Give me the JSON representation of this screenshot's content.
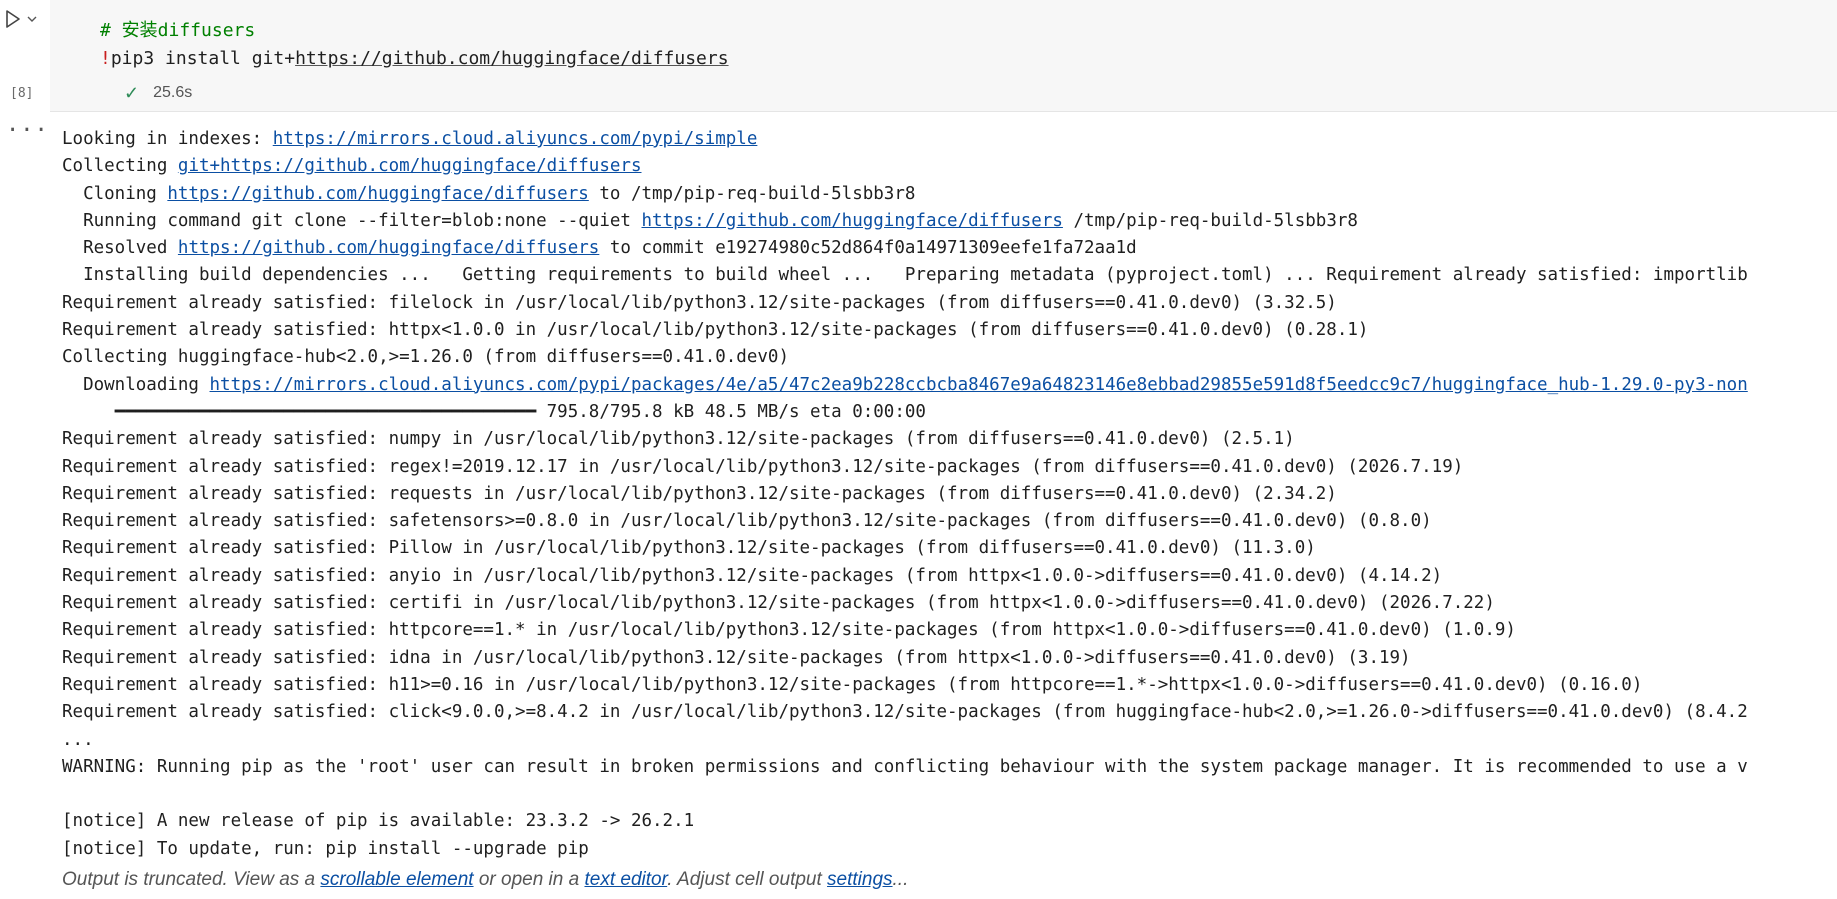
{
  "cell": {
    "code_comment": "# 安装diffusers",
    "code_bang": "!",
    "code_cmd": "pip3 install git+",
    "code_url": "https://github.com/huggingface/diffusers",
    "exec_count": "[8]",
    "duration": "25.6s",
    "run_icon": "play-icon",
    "chevron_icon": "chevron-down-icon",
    "more_icon": "ellipsis-icon"
  },
  "output": {
    "lines": [
      {
        "pre": "Looking in indexes: ",
        "link": "https://mirrors.cloud.aliyuncs.com/pypi/simple",
        "post": ""
      },
      {
        "pre": "Collecting ",
        "link": "git+https://github.com/huggingface/diffusers",
        "post": ""
      },
      {
        "pre": "  Cloning ",
        "link": "https://github.com/huggingface/diffusers",
        "post": " to /tmp/pip-req-build-5lsbb3r8"
      },
      {
        "pre": "  Running command git clone --filter=blob:none --quiet ",
        "link": "https://github.com/huggingface/diffusers",
        "post": " /tmp/pip-req-build-5lsbb3r8"
      },
      {
        "pre": "  Resolved ",
        "link": "https://github.com/huggingface/diffusers",
        "post": " to commit e19274980c52d864f0a14971309eefe1fa72aa1d"
      },
      {
        "pre": "  Installing build dependencies ...   Getting requirements to build wheel ...   Preparing metadata (pyproject.toml) ... Requirement already satisfied: importlib",
        "link": "",
        "post": ""
      },
      {
        "pre": "Requirement already satisfied: filelock in /usr/local/lib/python3.12/site-packages (from diffusers==0.41.0.dev0) (3.32.5)",
        "link": "",
        "post": ""
      },
      {
        "pre": "Requirement already satisfied: httpx<1.0.0 in /usr/local/lib/python3.12/site-packages (from diffusers==0.41.0.dev0) (0.28.1)",
        "link": "",
        "post": ""
      },
      {
        "pre": "Collecting huggingface-hub<2.0,>=1.26.0 (from diffusers==0.41.0.dev0)",
        "link": "",
        "post": ""
      },
      {
        "pre": "  Downloading ",
        "link": "https://mirrors.cloud.aliyuncs.com/pypi/packages/4e/a5/47c2ea9b228ccbcba8467e9a64823146e8ebbad29855e591d8f5eedcc9c7/huggingface_hub-1.29.0-py3-non",
        "post": ""
      },
      {
        "pre": "     ━━━━━━━━━━━━━━━━━━━━━━━━━━━━━━━━━━━━━━━━ 795.8/795.8 kB 48.5 MB/s eta 0:00:00",
        "link": "",
        "post": ""
      },
      {
        "pre": "Requirement already satisfied: numpy in /usr/local/lib/python3.12/site-packages (from diffusers==0.41.0.dev0) (2.5.1)",
        "link": "",
        "post": ""
      },
      {
        "pre": "Requirement already satisfied: regex!=2019.12.17 in /usr/local/lib/python3.12/site-packages (from diffusers==0.41.0.dev0) (2026.7.19)",
        "link": "",
        "post": ""
      },
      {
        "pre": "Requirement already satisfied: requests in /usr/local/lib/python3.12/site-packages (from diffusers==0.41.0.dev0) (2.34.2)",
        "link": "",
        "post": ""
      },
      {
        "pre": "Requirement already satisfied: safetensors>=0.8.0 in /usr/local/lib/python3.12/site-packages (from diffusers==0.41.0.dev0) (0.8.0)",
        "link": "",
        "post": ""
      },
      {
        "pre": "Requirement already satisfied: Pillow in /usr/local/lib/python3.12/site-packages (from diffusers==0.41.0.dev0) (11.3.0)",
        "link": "",
        "post": ""
      },
      {
        "pre": "Requirement already satisfied: anyio in /usr/local/lib/python3.12/site-packages (from httpx<1.0.0->diffusers==0.41.0.dev0) (4.14.2)",
        "link": "",
        "post": ""
      },
      {
        "pre": "Requirement already satisfied: certifi in /usr/local/lib/python3.12/site-packages (from httpx<1.0.0->diffusers==0.41.0.dev0) (2026.7.22)",
        "link": "",
        "post": ""
      },
      {
        "pre": "Requirement already satisfied: httpcore==1.* in /usr/local/lib/python3.12/site-packages (from httpx<1.0.0->diffusers==0.41.0.dev0) (1.0.9)",
        "link": "",
        "post": ""
      },
      {
        "pre": "Requirement already satisfied: idna in /usr/local/lib/python3.12/site-packages (from httpx<1.0.0->diffusers==0.41.0.dev0) (3.19)",
        "link": "",
        "post": ""
      },
      {
        "pre": "Requirement already satisfied: h11>=0.16 in /usr/local/lib/python3.12/site-packages (from httpcore==1.*->httpx<1.0.0->diffusers==0.41.0.dev0) (0.16.0)",
        "link": "",
        "post": ""
      },
      {
        "pre": "Requirement already satisfied: click<9.0.0,>=8.4.2 in /usr/local/lib/python3.12/site-packages (from huggingface-hub<2.0,>=1.26.0->diffusers==0.41.0.dev0) (8.4.2",
        "link": "",
        "post": ""
      },
      {
        "pre": "...",
        "link": "",
        "post": ""
      },
      {
        "pre": "WARNING: Running pip as the 'root' user can result in broken permissions and conflicting behaviour with the system package manager. It is recommended to use a v",
        "link": "",
        "post": ""
      },
      {
        "pre": "",
        "link": "",
        "post": ""
      },
      {
        "pre": "[notice] A new release of pip is available: 23.3.2 -> 26.2.1",
        "link": "",
        "post": ""
      },
      {
        "pre": "[notice] To update, run: pip install --upgrade pip",
        "link": "",
        "post": ""
      }
    ]
  },
  "footer": {
    "t1": "Output is truncated. View as a ",
    "link1": "scrollable element",
    "t2": " or open in a ",
    "link2": "text editor",
    "t3": ". Adjust cell output ",
    "link3": "settings",
    "t4": "..."
  }
}
